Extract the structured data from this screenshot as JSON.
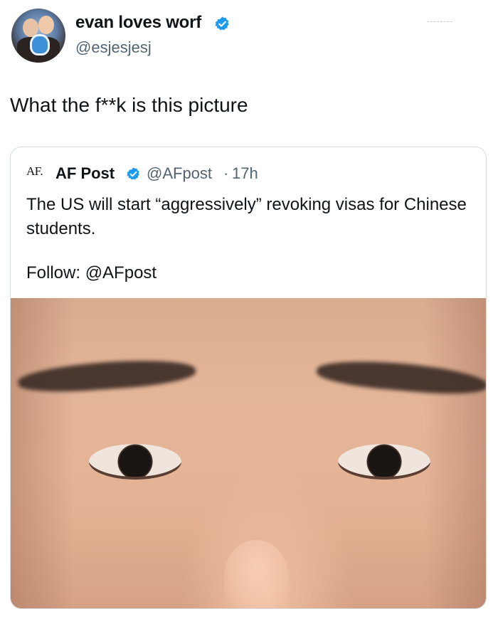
{
  "author": {
    "display_name": "evan loves worf",
    "handle": "@esjesjesj",
    "verified": true
  },
  "tweet": {
    "text": "What the f**k is this picture"
  },
  "quoted": {
    "avatar_text": "AF.",
    "display_name": "AF Post",
    "handle": "@AFpost",
    "separator": "·",
    "time": "17h",
    "text": "The US will start “aggressively” revoking visas for Chinese students.",
    "follow": "Follow: @AFpost",
    "media_description": "close-up photo of a face"
  },
  "colors": {
    "verified_blue": "#1d9bf0",
    "secondary_text": "#536471",
    "border": "#d7dde2"
  }
}
